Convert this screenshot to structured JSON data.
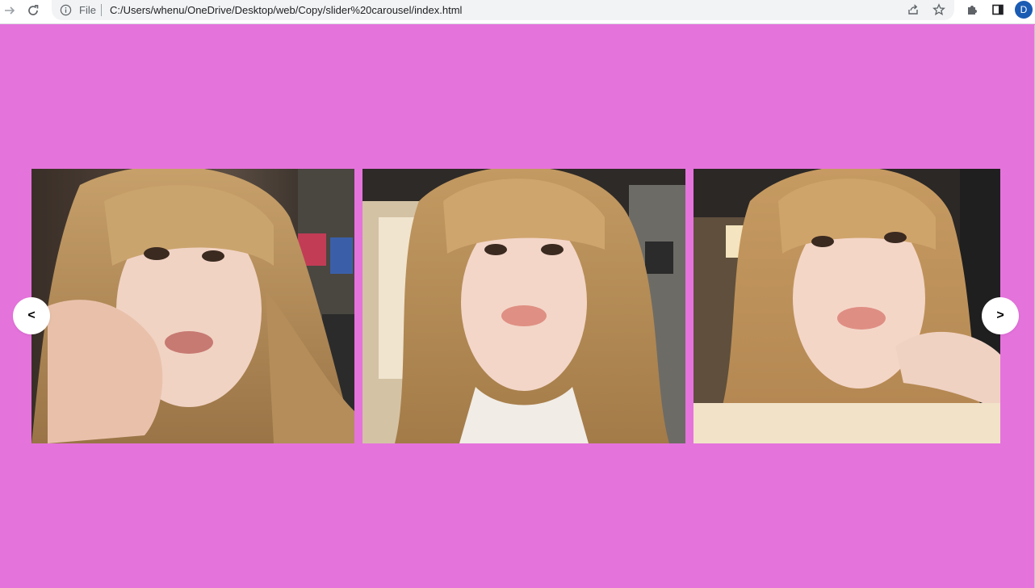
{
  "browser": {
    "file_label": "File",
    "url": "C:/Users/whenu/OneDrive/Desktop/web/Copy/slider%20carousel/index.html",
    "profile_initial": "D",
    "icons": [
      "forward-icon",
      "reload-icon",
      "info-icon",
      "share-icon",
      "star-icon",
      "extensions-icon",
      "side-panel-icon"
    ]
  },
  "page": {
    "background_color": "#e573dc"
  },
  "carousel": {
    "prev_label": "<",
    "next_label": ">",
    "slides": [
      {
        "description": "photo"
      },
      {
        "description": "photo"
      },
      {
        "description": "photo"
      }
    ]
  }
}
